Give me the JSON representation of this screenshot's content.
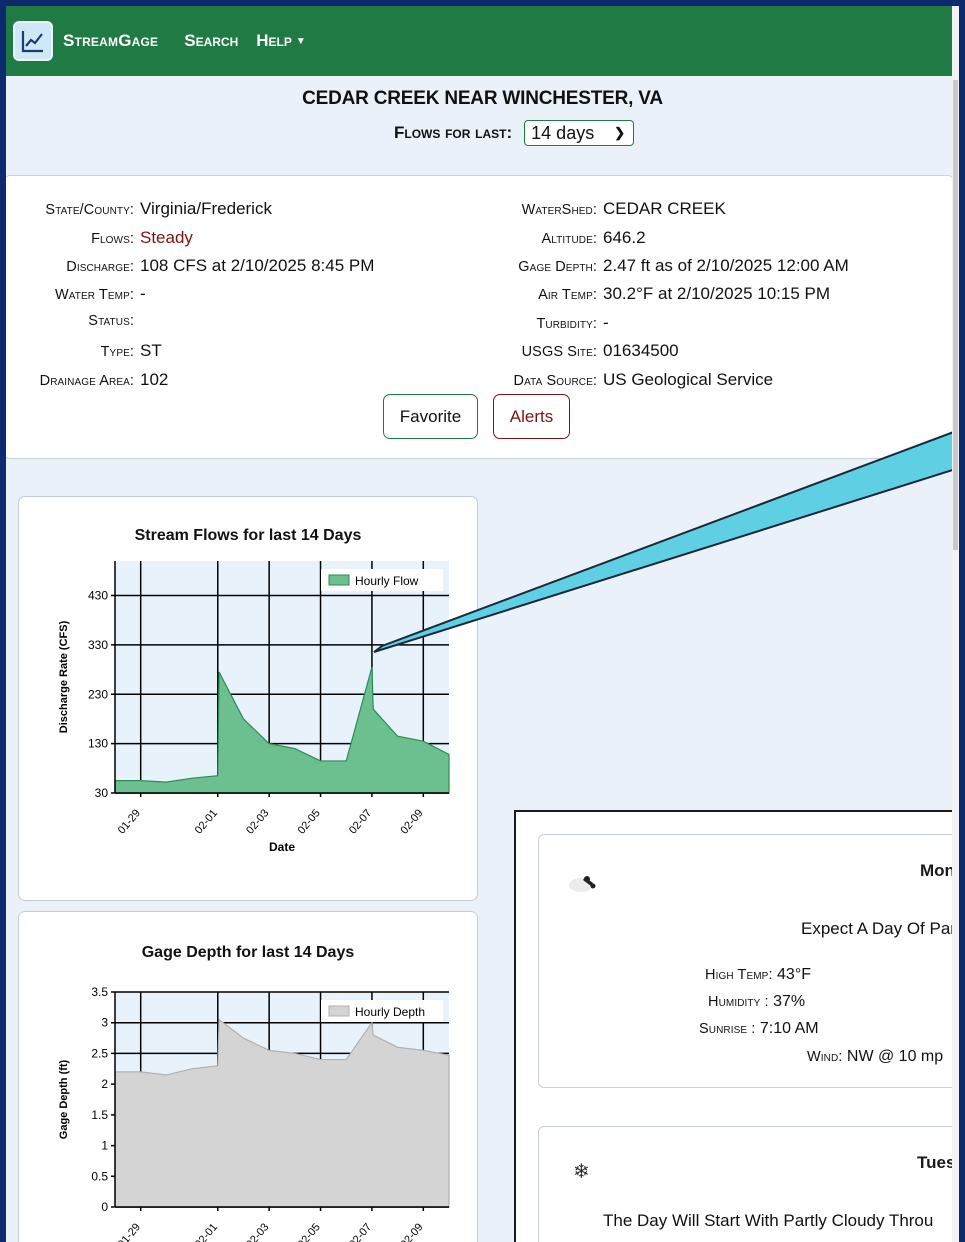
{
  "nav": {
    "brand": "StreamGage",
    "search": "Search",
    "help": "Help"
  },
  "header": {
    "title": "CEDAR CREEK NEAR WINCHESTER, VA",
    "flows_label": "Flows for last:",
    "flows_value": "14 days"
  },
  "info": {
    "left": [
      {
        "label": "State/County:",
        "value": "Virginia/Frederick"
      },
      {
        "label": "Flows:",
        "value": "Steady"
      },
      {
        "label": "Discharge:",
        "value": "108 CFS at 2/10/2025 8:45 PM"
      },
      {
        "label": "Water Temp:",
        "value": "-"
      },
      {
        "label": "Status:",
        "value": ""
      },
      {
        "label": "Type:",
        "value": "ST"
      },
      {
        "label": "Drainage Area:",
        "value": "102"
      }
    ],
    "right": [
      {
        "label": "WaterShed:",
        "value": "CEDAR CREEK"
      },
      {
        "label": "Altitude:",
        "value": "646.2"
      },
      {
        "label": "Gage Depth:",
        "value": "2.47 ft as of 2/10/2025 12:00 AM"
      },
      {
        "label": "Air Temp:",
        "value": "30.2°F at 2/10/2025 10:15 PM"
      },
      {
        "label": "Turbidity:",
        "value": "-"
      },
      {
        "label": "USGS Site:",
        "value": "01634500"
      },
      {
        "label": "Data Source:",
        "value": "US Geological Service"
      }
    ],
    "favorite_label": "Favorite",
    "alerts_label": "Alerts"
  },
  "weather": {
    "day1": {
      "day": "Monda",
      "desc": "Expect A Day Of Par",
      "high_label": "High Temp:",
      "high_value": "43°F",
      "humidity_label": "Humidity :",
      "humidity_value": "37%",
      "sunrise_label": "Sunrise :",
      "sunrise_value": "7:10 AM",
      "wind_label": "Wind:",
      "wind_value": "NW @ 10 mp"
    },
    "day2": {
      "day": "Tuesd",
      "desc": "The Day Will Start With Partly Cloudy Throu"
    }
  },
  "colors": {
    "nav": "#1f7a44",
    "flow_fill": "#6cc090",
    "depth_fill": "#d4d4d4",
    "arrow": "#5fd0e3"
  },
  "chart_data": [
    {
      "type": "area",
      "title": "Stream Flows for last 14 Days",
      "xlabel": "Date",
      "ylabel": "Discharge Rate (CFS)",
      "legend": "top-right",
      "ylim": [
        30,
        500
      ],
      "yticks": [
        "30",
        "130",
        "230",
        "330",
        "430"
      ],
      "xticks": [
        "01-29",
        "02-01",
        "02-03",
        "02-05",
        "02-07",
        "02-09"
      ],
      "series": [
        {
          "name": "Hourly Flow",
          "x": [
            "01-28",
            "01-29",
            "01-30",
            "01-31",
            "02-01",
            "02-01",
            "02-02",
            "02-03",
            "02-04",
            "02-05",
            "02-06",
            "02-07",
            "02-07",
            "02-08",
            "02-09",
            "02-10"
          ],
          "values": [
            55,
            55,
            52,
            60,
            65,
            275,
            180,
            130,
            120,
            95,
            95,
            285,
            200,
            145,
            135,
            108
          ]
        }
      ]
    },
    {
      "type": "area",
      "title": "Gage Depth for last 14 Days",
      "xlabel": "",
      "ylabel": "Gage Depth (ft)",
      "legend": "top-right",
      "ylim": [
        0,
        3.5
      ],
      "yticks": [
        "0",
        "0.5",
        "1",
        "1.5",
        "2",
        "2.5",
        "3",
        "3.5"
      ],
      "xticks": [
        "01-29",
        "02-01",
        "02-03",
        "02-05",
        "02-07",
        "02-09"
      ],
      "series": [
        {
          "name": "Hourly Depth",
          "x": [
            "01-28",
            "01-29",
            "01-30",
            "01-31",
            "02-01",
            "02-01",
            "02-02",
            "02-03",
            "02-04",
            "02-05",
            "02-06",
            "02-07",
            "02-07",
            "02-08",
            "02-09",
            "02-10"
          ],
          "values": [
            2.2,
            2.2,
            2.15,
            2.25,
            2.3,
            3.05,
            2.75,
            2.55,
            2.5,
            2.4,
            2.4,
            3.0,
            2.8,
            2.6,
            2.55,
            2.47
          ]
        }
      ]
    }
  ]
}
